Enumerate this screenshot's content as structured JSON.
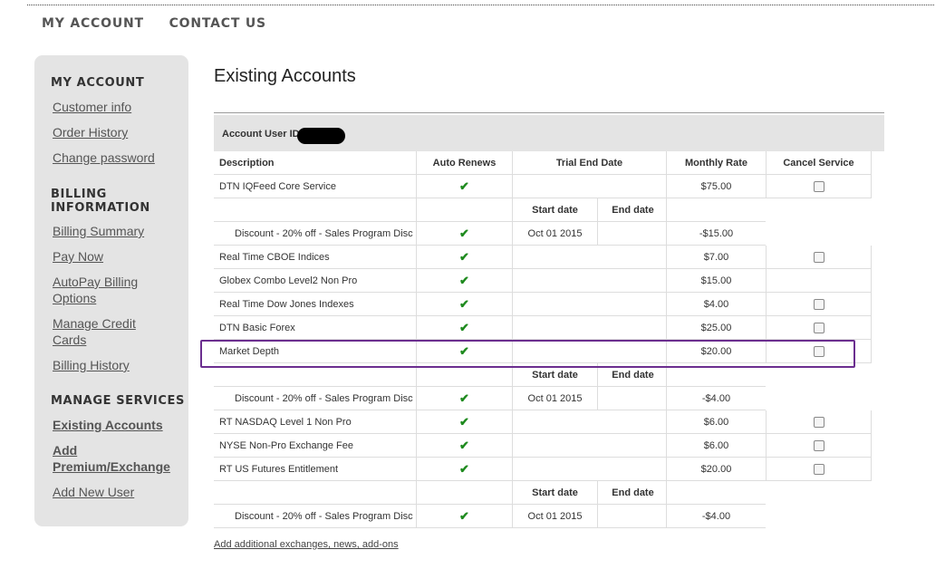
{
  "topnav": {
    "my_account": "MY ACCOUNT",
    "contact_us": "CONTACT US"
  },
  "sidebar": {
    "my_account_heading": "MY ACCOUNT",
    "customer_info": "Customer info",
    "order_history": "Order History",
    "change_password": "Change password",
    "billing_heading_1": "BILLING",
    "billing_heading_2": "INFORMATION",
    "billing_summary": "Billing Summary",
    "pay_now": "Pay Now",
    "autopay_1": "AutoPay Billing",
    "autopay_2": "Options",
    "manage_cc_1": "Manage Credit",
    "manage_cc_2": "Cards",
    "billing_history": "Billing History",
    "manage_services_heading": "MANAGE SERVICES",
    "existing_accounts": "Existing Accounts",
    "add_premium_1": "Add",
    "add_premium_2": "Premium/Exchange",
    "add_new_user": "Add New User"
  },
  "page_title": "Existing Accounts",
  "account_user_id_label": "Account User ID",
  "columns": {
    "description": "Description",
    "auto_renews": "Auto Renews",
    "trial_end_date": "Trial End Date",
    "monthly_rate": "Monthly Rate",
    "cancel_service": "Cancel Service"
  },
  "subheader": {
    "start_date": "Start date",
    "end_date": "End date"
  },
  "checkmark": "✔",
  "rows": [
    {
      "description": "DTN IQFeed Core Service",
      "rate": "$75.00"
    },
    {
      "description": "Discount - 20% off - Sales Program Disc",
      "start": "Oct 01 2015",
      "rate": "-$15.00"
    },
    {
      "description": "Real Time CBOE Indices",
      "rate": "$7.00"
    },
    {
      "description": "Globex Combo Level2 Non Pro",
      "rate": "$15.00"
    },
    {
      "description": "Real Time Dow Jones Indexes",
      "rate": "$4.00"
    },
    {
      "description": "DTN Basic Forex",
      "rate": "$25.00"
    },
    {
      "description": "Market Depth",
      "rate": "$20.00"
    },
    {
      "description": "Discount - 20% off - Sales Program Disc",
      "start": "Oct 01 2015",
      "rate": "-$4.00"
    },
    {
      "description": "RT NASDAQ Level 1 Non Pro",
      "rate": "$6.00"
    },
    {
      "description": "NYSE Non-Pro Exchange Fee",
      "rate": "$6.00"
    },
    {
      "description": "RT US Futures Entitlement",
      "rate": "$20.00"
    },
    {
      "description": "Discount - 20% off - Sales Program Disc",
      "start": "Oct 01 2015",
      "rate": "-$4.00"
    }
  ],
  "add_link": "Add additional exchanges, news, add-ons",
  "colors": {
    "highlight_border": "#6b2e8f",
    "check_green": "#1e8a1e",
    "sidebar_bg": "#e4e4e4"
  }
}
